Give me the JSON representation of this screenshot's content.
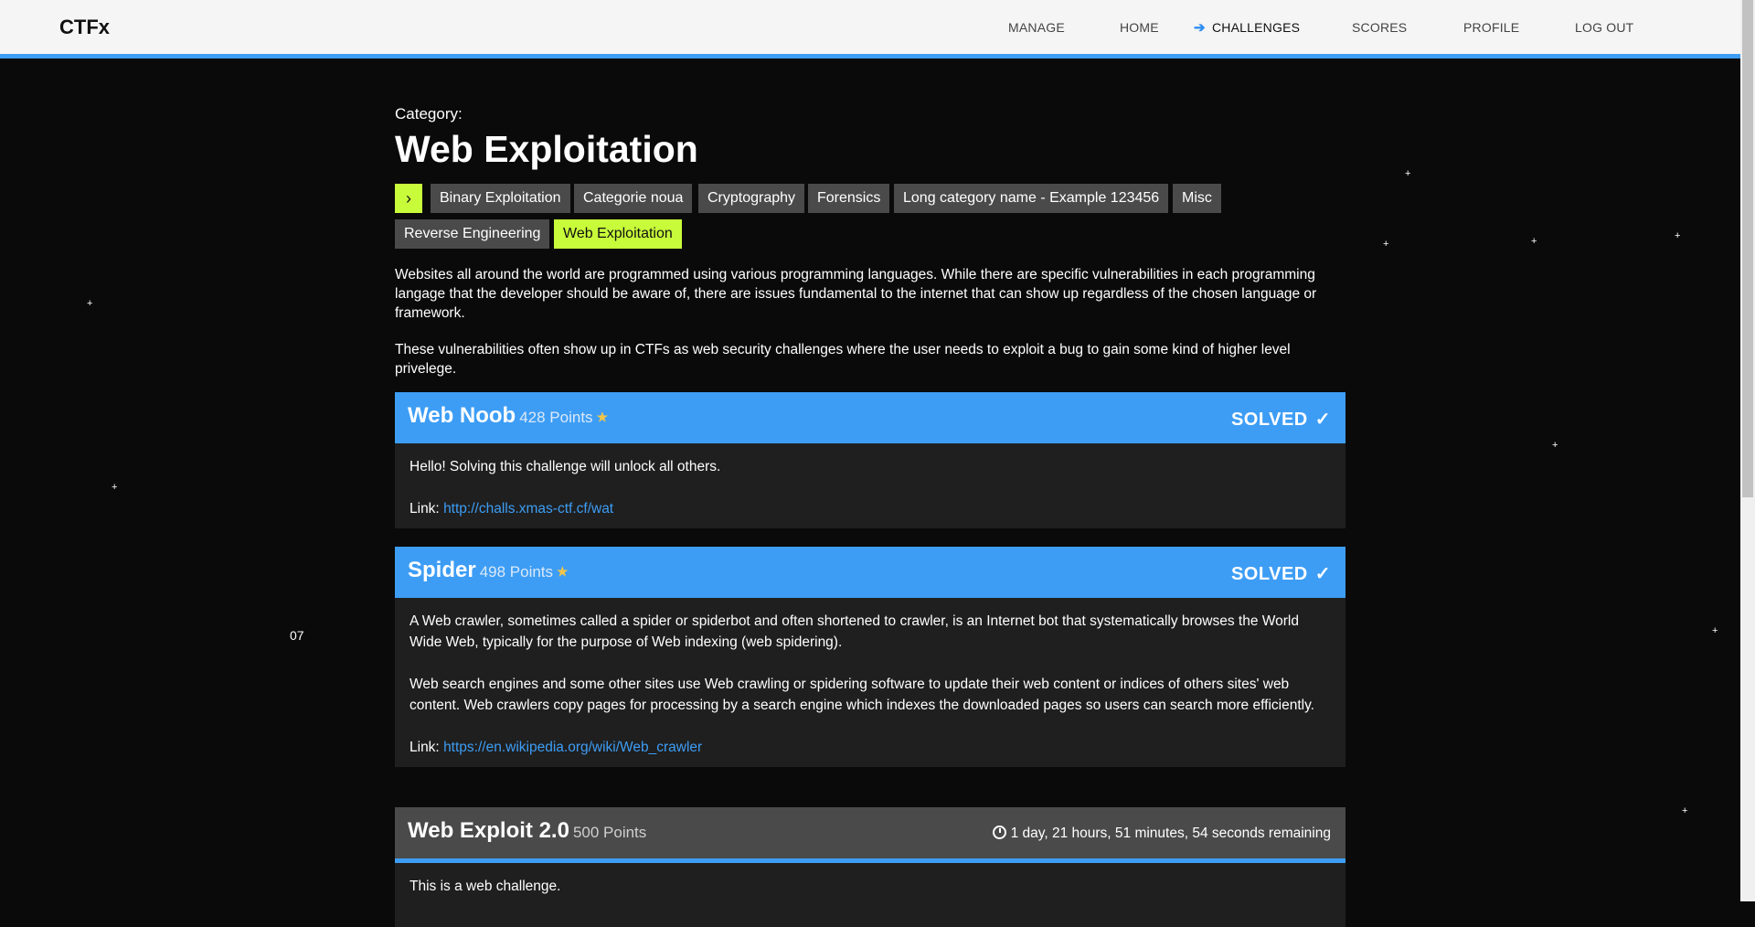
{
  "nav": {
    "brand": "CTFx",
    "links": [
      "MANAGE",
      "HOME",
      "CHALLENGES",
      "SCORES",
      "PROFILE",
      "LOG OUT"
    ],
    "active": "CHALLENGES"
  },
  "category": {
    "label": "Category:",
    "title": "Web Exploitation",
    "toggle_glyph": "›",
    "tags": [
      "Binary Exploitation",
      "Categorie noua",
      "Cryptography",
      "Forensics",
      "Long category name - Example 123456",
      "Misc",
      "Reverse Engineering",
      "Web Exploitation"
    ],
    "selected": "Web Exploitation",
    "description": [
      "Websites all around the world are programmed using various programming languages. While there are specific vulnerabilities in each programming langage that the developer should be aware of, there are issues fundamental to the internet that can show up regardless of the chosen language or framework.",
      "These vulnerabilities often show up in CTFs as web security challenges where the user needs to exploit a bug to gain some kind of higher level privelege."
    ]
  },
  "side_number": "07",
  "challenges": [
    {
      "title": "Web Noob",
      "points": "428 Points",
      "status": "SOLVED",
      "body": [
        "Hello! Solving this challenge will unlock all others."
      ],
      "link_label": "Link:",
      "link": "http://challs.xmas-ctf.cf/wat"
    },
    {
      "title": "Spider",
      "points": "498 Points",
      "status": "SOLVED",
      "body": [
        "A Web crawler, sometimes called a spider or spiderbot and often shortened to crawler, is an Internet bot that systematically browses the World Wide Web, typically for the purpose of Web indexing (web spidering).",
        "Web search engines and some other sites use Web crawling or spidering software to update their web content or indices of others sites' web content. Web crawlers copy pages for processing by a search engine which indexes the downloaded pages so users can search more efficiently."
      ],
      "link_label": "Link:",
      "link": "https://en.wikipedia.org/wiki/Web_crawler"
    },
    {
      "title": "Web Exploit 2.0",
      "points": "500 Points",
      "timer": "1 day, 21 hours, 51 minutes, 54 seconds remaining",
      "body": [
        "This is a web challenge."
      ]
    }
  ],
  "colors": {
    "accent": "#3d9df5",
    "selected_tag": "#c8fb3a",
    "tag": "#4a4a4a",
    "card_body": "#1f1f1f",
    "background": "#0a0a0a"
  }
}
